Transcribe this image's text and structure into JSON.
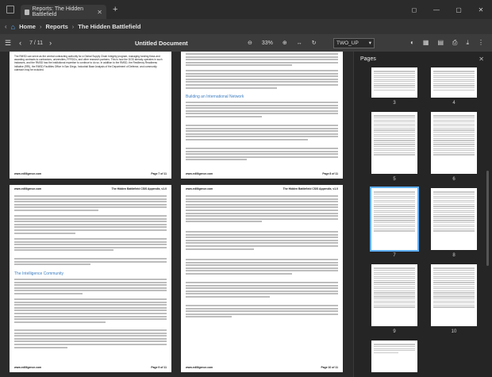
{
  "tab": {
    "title": "Reports: The Hidden Battlefield"
  },
  "breadcrumb": {
    "home": "Home",
    "section": "Reports",
    "current": "The Hidden Battlefield"
  },
  "toolbar": {
    "page_indicator": "7 / 11",
    "doc_title": "Untitled Document",
    "zoom": "33%",
    "layout": "TWO_UP"
  },
  "pages": [
    {
      "id": "p7",
      "footer_left": "www.edilligence.com",
      "footer_right": "Page 7 of 11",
      "intro": "The RMSD can serve as the central contracting authority for a Global Supply Chain Integrity program, managing funding flows and awarding contracts to contractors, universities, FFRDCs, and other research partners. This is how the DOD already operates in such instances, and the RMSD has the institutional expertise to continue to do so. In addition to the RMSD, the Resiliency Readiness Initiative (RRI), the RMSD Facilities Office in San Diego, Industrial Base Analysis of the Department of Defense, and community outreach may be included."
    },
    {
      "id": "p8",
      "footer_left": "www.edilligence.com",
      "footer_right": "Page 8 of 11",
      "subhead": "Building an International Network"
    },
    {
      "id": "p9",
      "header_left": "www.edilligence.com",
      "header_right": "The Hidden Battlefield CSIS Appendix, v1.0",
      "footer_left": "www.edilligence.com",
      "footer_right": "Page 9 of 11",
      "subhead": "The Intelligence Community"
    },
    {
      "id": "p10",
      "header_left": "www.edilligence.com",
      "header_right": "The Hidden Battlefield CSIS Appendix, v1.0",
      "footer_left": "www.edilligence.com",
      "footer_right": "Page 10 of 11"
    }
  ],
  "sidebar": {
    "title": "Pages",
    "thumb_numbers": [
      "3",
      "4",
      "5",
      "6",
      "7",
      "8",
      "9",
      "10"
    ]
  }
}
